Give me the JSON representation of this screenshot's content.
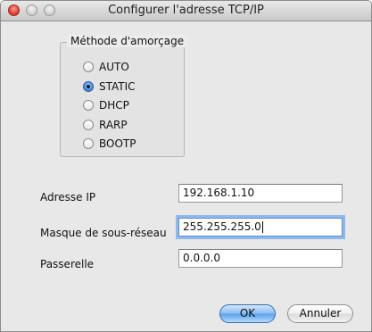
{
  "window": {
    "title": "Configurer l'adresse TCP/IP"
  },
  "boot_method": {
    "legend": "Méthode d'amorçage",
    "options": [
      {
        "label": "AUTO",
        "selected": false
      },
      {
        "label": "STATIC",
        "selected": true
      },
      {
        "label": "DHCP",
        "selected": false
      },
      {
        "label": "RARP",
        "selected": false
      },
      {
        "label": "BOOTP",
        "selected": false
      }
    ]
  },
  "fields": {
    "ip_label": "Adresse IP",
    "ip_value": "192.168.1.10",
    "mask_label": "Masque de sous-réseau",
    "mask_value": "255.255.255.0",
    "gateway_label": "Passerelle",
    "gateway_value": "0.0.0.0"
  },
  "buttons": {
    "ok_label": "OK",
    "cancel_label": "Annuler"
  }
}
